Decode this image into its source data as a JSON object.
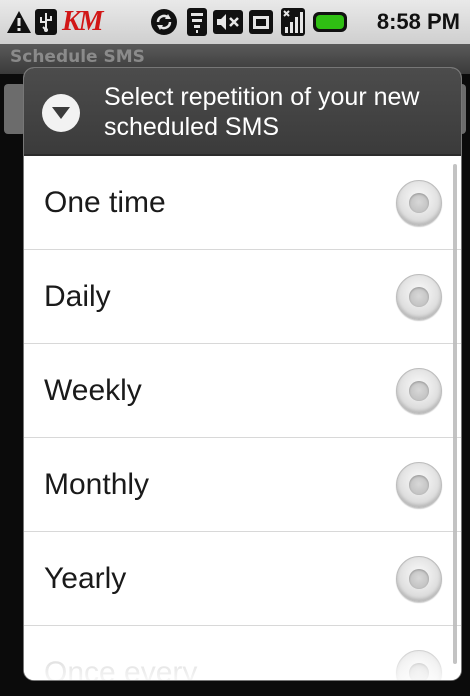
{
  "status_bar": {
    "time": "8:58 PM",
    "brand": "KM",
    "icons": [
      "warning-icon",
      "usb-icon",
      "sync-icon",
      "wifi-icon",
      "volume-muted-icon",
      "sd-card-icon",
      "signal-icon",
      "battery-icon"
    ],
    "battery_color": "#2fbf13"
  },
  "app": {
    "title": "Schedule SMS"
  },
  "dialog": {
    "icon": "chevron-down-circle-icon",
    "title": "Select repetition of your new scheduled SMS",
    "options": [
      {
        "label": "One time"
      },
      {
        "label": "Daily"
      },
      {
        "label": "Weekly"
      },
      {
        "label": "Monthly"
      },
      {
        "label": "Yearly"
      },
      {
        "label": "Once every"
      }
    ]
  }
}
